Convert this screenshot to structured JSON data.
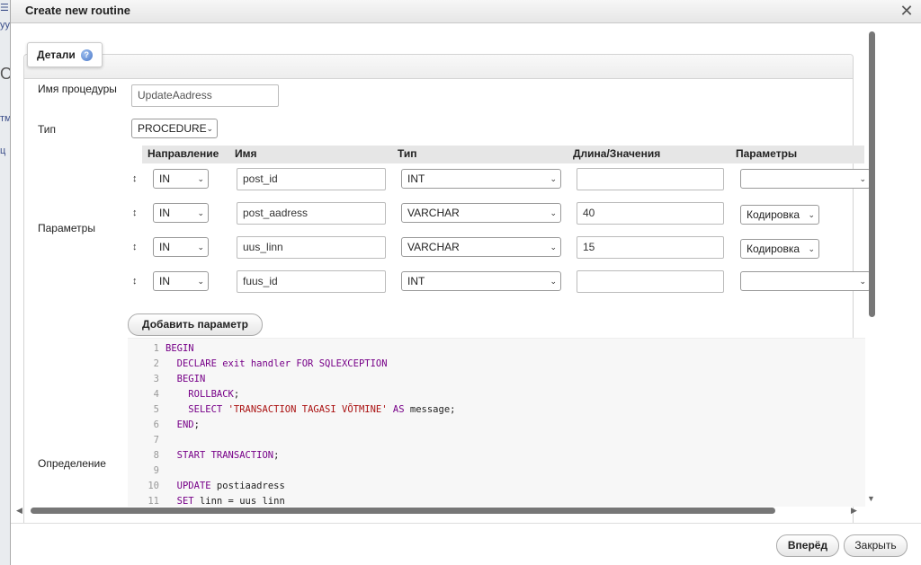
{
  "background": {
    "fragments": [
      "☰",
      "уу",
      "O",
      "тм",
      "ц"
    ]
  },
  "dialog": {
    "title": "Create new routine",
    "close_icon": "✕"
  },
  "tab": {
    "label": "Детали",
    "help_icon": "?"
  },
  "form": {
    "name_label": "Имя процедуры",
    "name_value": "UpdateAadress",
    "type_label": "Тип",
    "type_value": "PROCEDURE",
    "params_label": "Параметры",
    "definition_label": "Определение"
  },
  "params_table": {
    "headers": [
      "Направление",
      "Имя",
      "Тип",
      "Длина/Значения",
      "Параметры"
    ],
    "rows": [
      {
        "handle": "↕",
        "direction": "IN",
        "name": "post_id",
        "type": "INT",
        "length": "",
        "option": ""
      },
      {
        "handle": "↕",
        "direction": "IN",
        "name": "post_aadress",
        "type": "VARCHAR",
        "length": "40",
        "option": "Кодировка"
      },
      {
        "handle": "↕",
        "direction": "IN",
        "name": "uus_linn",
        "type": "VARCHAR",
        "length": "15",
        "option": "Кодировка"
      },
      {
        "handle": "↕",
        "direction": "IN",
        "name": "fuus_id",
        "type": "INT",
        "length": "",
        "option": ""
      }
    ],
    "add_button": "Добавить параметр"
  },
  "code_lines": [
    "1",
    "2",
    "3",
    "4",
    "5",
    "6",
    "7",
    "8",
    "9",
    "10",
    "11"
  ],
  "code": {
    "l1_kw": "BEGIN",
    "l2_kw": "DECLARE exit handler FOR SQLEXCEPTION",
    "l3_kw": "BEGIN",
    "l4_kw": "ROLLBACK",
    "l4_tx": ";",
    "l5_kw": "SELECT",
    "l5_str": "'TRANSACTION TAGASI VÕTMINE'",
    "l5_kw2": "AS",
    "l5_tx": "message;",
    "l6_kw": "END",
    "l6_tx": ";",
    "l8_kw": "START TRANSACTION",
    "l8_tx": ";",
    "l10_kw": "UPDATE",
    "l10_tx": "postiaadress",
    "l11_kw": "SET",
    "l11_tx": "linn = uus linn"
  },
  "footer": {
    "next_button": "Вперёд",
    "close_button": "Закрыть"
  },
  "icons": {
    "chevron": "⌄",
    "arrow_up": "▲",
    "arrow_down": "▼",
    "arrow_left": "◀",
    "arrow_right": "▶"
  }
}
